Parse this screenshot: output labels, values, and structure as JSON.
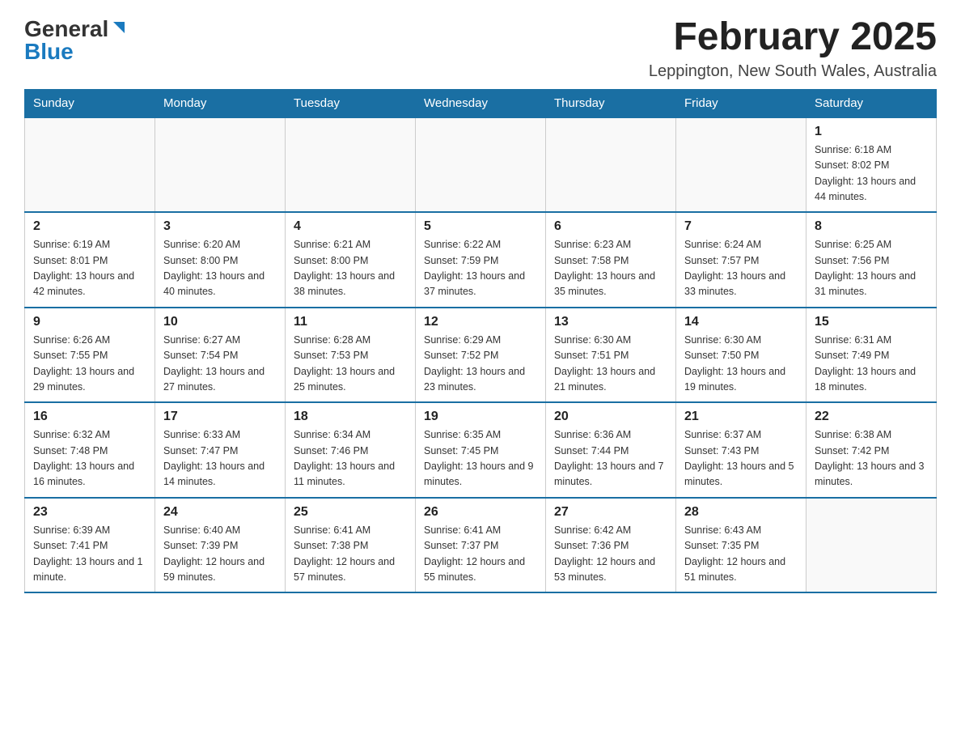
{
  "header": {
    "logo_text_general": "General",
    "logo_text_blue": "Blue",
    "month_title": "February 2025",
    "location": "Leppington, New South Wales, Australia"
  },
  "days_of_week": [
    "Sunday",
    "Monday",
    "Tuesday",
    "Wednesday",
    "Thursday",
    "Friday",
    "Saturday"
  ],
  "weeks": [
    [
      {
        "day": "",
        "info": ""
      },
      {
        "day": "",
        "info": ""
      },
      {
        "day": "",
        "info": ""
      },
      {
        "day": "",
        "info": ""
      },
      {
        "day": "",
        "info": ""
      },
      {
        "day": "",
        "info": ""
      },
      {
        "day": "1",
        "info": "Sunrise: 6:18 AM\nSunset: 8:02 PM\nDaylight: 13 hours and 44 minutes."
      }
    ],
    [
      {
        "day": "2",
        "info": "Sunrise: 6:19 AM\nSunset: 8:01 PM\nDaylight: 13 hours and 42 minutes."
      },
      {
        "day": "3",
        "info": "Sunrise: 6:20 AM\nSunset: 8:00 PM\nDaylight: 13 hours and 40 minutes."
      },
      {
        "day": "4",
        "info": "Sunrise: 6:21 AM\nSunset: 8:00 PM\nDaylight: 13 hours and 38 minutes."
      },
      {
        "day": "5",
        "info": "Sunrise: 6:22 AM\nSunset: 7:59 PM\nDaylight: 13 hours and 37 minutes."
      },
      {
        "day": "6",
        "info": "Sunrise: 6:23 AM\nSunset: 7:58 PM\nDaylight: 13 hours and 35 minutes."
      },
      {
        "day": "7",
        "info": "Sunrise: 6:24 AM\nSunset: 7:57 PM\nDaylight: 13 hours and 33 minutes."
      },
      {
        "day": "8",
        "info": "Sunrise: 6:25 AM\nSunset: 7:56 PM\nDaylight: 13 hours and 31 minutes."
      }
    ],
    [
      {
        "day": "9",
        "info": "Sunrise: 6:26 AM\nSunset: 7:55 PM\nDaylight: 13 hours and 29 minutes."
      },
      {
        "day": "10",
        "info": "Sunrise: 6:27 AM\nSunset: 7:54 PM\nDaylight: 13 hours and 27 minutes."
      },
      {
        "day": "11",
        "info": "Sunrise: 6:28 AM\nSunset: 7:53 PM\nDaylight: 13 hours and 25 minutes."
      },
      {
        "day": "12",
        "info": "Sunrise: 6:29 AM\nSunset: 7:52 PM\nDaylight: 13 hours and 23 minutes."
      },
      {
        "day": "13",
        "info": "Sunrise: 6:30 AM\nSunset: 7:51 PM\nDaylight: 13 hours and 21 minutes."
      },
      {
        "day": "14",
        "info": "Sunrise: 6:30 AM\nSunset: 7:50 PM\nDaylight: 13 hours and 19 minutes."
      },
      {
        "day": "15",
        "info": "Sunrise: 6:31 AM\nSunset: 7:49 PM\nDaylight: 13 hours and 18 minutes."
      }
    ],
    [
      {
        "day": "16",
        "info": "Sunrise: 6:32 AM\nSunset: 7:48 PM\nDaylight: 13 hours and 16 minutes."
      },
      {
        "day": "17",
        "info": "Sunrise: 6:33 AM\nSunset: 7:47 PM\nDaylight: 13 hours and 14 minutes."
      },
      {
        "day": "18",
        "info": "Sunrise: 6:34 AM\nSunset: 7:46 PM\nDaylight: 13 hours and 11 minutes."
      },
      {
        "day": "19",
        "info": "Sunrise: 6:35 AM\nSunset: 7:45 PM\nDaylight: 13 hours and 9 minutes."
      },
      {
        "day": "20",
        "info": "Sunrise: 6:36 AM\nSunset: 7:44 PM\nDaylight: 13 hours and 7 minutes."
      },
      {
        "day": "21",
        "info": "Sunrise: 6:37 AM\nSunset: 7:43 PM\nDaylight: 13 hours and 5 minutes."
      },
      {
        "day": "22",
        "info": "Sunrise: 6:38 AM\nSunset: 7:42 PM\nDaylight: 13 hours and 3 minutes."
      }
    ],
    [
      {
        "day": "23",
        "info": "Sunrise: 6:39 AM\nSunset: 7:41 PM\nDaylight: 13 hours and 1 minute."
      },
      {
        "day": "24",
        "info": "Sunrise: 6:40 AM\nSunset: 7:39 PM\nDaylight: 12 hours and 59 minutes."
      },
      {
        "day": "25",
        "info": "Sunrise: 6:41 AM\nSunset: 7:38 PM\nDaylight: 12 hours and 57 minutes."
      },
      {
        "day": "26",
        "info": "Sunrise: 6:41 AM\nSunset: 7:37 PM\nDaylight: 12 hours and 55 minutes."
      },
      {
        "day": "27",
        "info": "Sunrise: 6:42 AM\nSunset: 7:36 PM\nDaylight: 12 hours and 53 minutes."
      },
      {
        "day": "28",
        "info": "Sunrise: 6:43 AM\nSunset: 7:35 PM\nDaylight: 12 hours and 51 minutes."
      },
      {
        "day": "",
        "info": ""
      }
    ]
  ]
}
